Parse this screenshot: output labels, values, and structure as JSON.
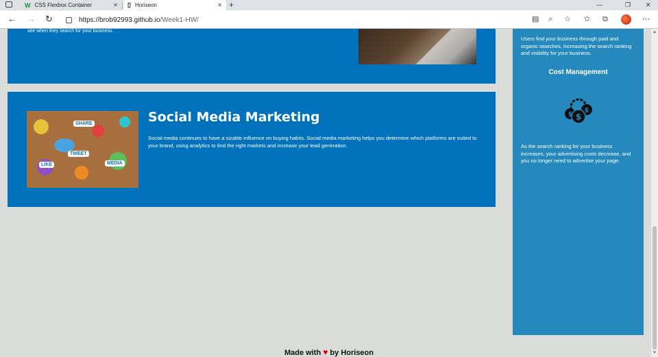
{
  "browser": {
    "tabs": [
      {
        "title": "CSS Flexbox Container",
        "favicon": "W",
        "active": false
      },
      {
        "title": "Horiseon",
        "favicon": "page-icon",
        "active": true
      }
    ],
    "url_domain": "https://brob92993.github.io",
    "url_path": "/Week1-HW/",
    "new_tab": "+",
    "window_controls": [
      "—",
      "❐",
      "✕"
    ]
  },
  "page": {
    "top_card_tail": "see when they search for your business.",
    "social": {
      "heading": "Social Media Marketing",
      "body": "Social media continues to have a sizable influence on buying habits. Social media marketing helps you determine which platforms are suited to your brand, using analytics to find the right markets and increase your lead generation.",
      "image_tags": [
        "SHARE",
        "TWEET",
        "LIKE",
        "MEDIA"
      ]
    },
    "aside": {
      "top_text": "Users find your business through paid and organic searches, increasing the search ranking and visibility for your business.",
      "cost_heading": "Cost Management",
      "cost_text": "As the search ranking for your business increases, your advertising costs decrease, and you no longer need to advertise your page."
    },
    "footer": {
      "made_with": "Made with",
      "by": "by Horiseon"
    }
  },
  "colors": {
    "card_blue": "#0072bb",
    "aside_blue": "#2589bd",
    "page_bg": "#d9dcd9"
  }
}
